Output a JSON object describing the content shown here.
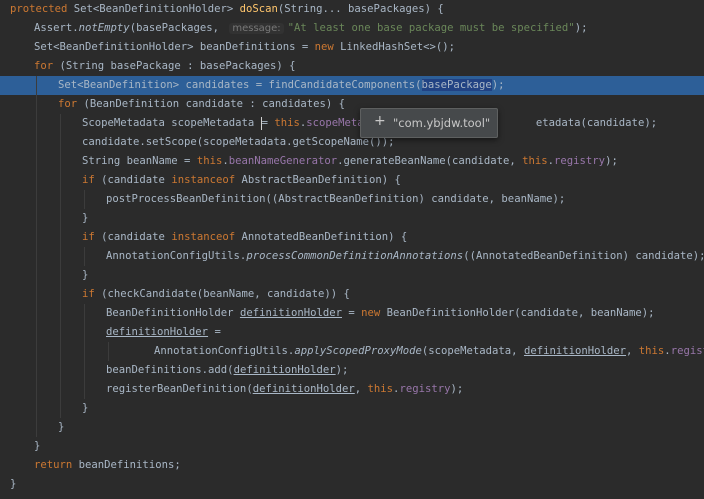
{
  "editor": {
    "lines": [
      {
        "tokens": [
          {
            "t": "protected ",
            "c": "kw"
          },
          {
            "t": "Set<BeanDefinitionHolder> "
          },
          {
            "t": "doScan",
            "c": "fn"
          },
          {
            "t": "(String... basePackages) {"
          }
        ]
      },
      {
        "tokens": [
          {
            "t": "Assert."
          },
          {
            "t": "notEmpty",
            "c": "it"
          },
          {
            "t": "(basePackages, "
          },
          {
            "t": "message:",
            "c": "hint"
          },
          {
            "t": "\"At least one base package must be specified\"",
            "c": "str"
          },
          {
            "t": ");"
          }
        ]
      },
      {
        "tokens": [
          {
            "t": "Set<BeanDefinitionHolder> beanDefinitions = "
          },
          {
            "t": "new ",
            "c": "kw"
          },
          {
            "t": "LinkedHashSet<>();"
          }
        ]
      },
      {
        "tokens": [
          {
            "t": "for ",
            "c": "kw"
          },
          {
            "t": "(String basePackage : basePackages) {"
          }
        ]
      },
      {
        "highlight": true,
        "tokens": [
          {
            "t": "Set<BeanDefinition> candidates = findCandidateComponents("
          },
          {
            "t": "basePackage",
            "c": "sel"
          },
          {
            "t": ");"
          }
        ]
      },
      {
        "tokens": [
          {
            "t": "for ",
            "c": "kw"
          },
          {
            "t": "(BeanDefinition candidate : candidates) {"
          }
        ]
      },
      {
        "tokens": [
          {
            "t": "ScopeMetadata scopeMetadata "
          },
          {
            "t": "",
            "c": "caret"
          },
          {
            "t": "= "
          },
          {
            "t": "this",
            "c": "kw"
          },
          {
            "t": "."
          },
          {
            "t": "scopeMetada",
            "c": "fld"
          },
          {
            "t": "                         "
          },
          {
            "t": "etadata(candidate);"
          }
        ]
      },
      {
        "tokens": [
          {
            "t": "candidate.setScope(scopeMetadata.getScopeName());"
          }
        ]
      },
      {
        "tokens": [
          {
            "t": "String beanName = "
          },
          {
            "t": "this",
            "c": "kw"
          },
          {
            "t": "."
          },
          {
            "t": "beanNameGenerator",
            "c": "fld"
          },
          {
            "t": ".generateBeanName(candidate, "
          },
          {
            "t": "this",
            "c": "kw"
          },
          {
            "t": "."
          },
          {
            "t": "registry",
            "c": "fld"
          },
          {
            "t": ");"
          }
        ]
      },
      {
        "tokens": [
          {
            "t": "if ",
            "c": "kw"
          },
          {
            "t": "(candidate "
          },
          {
            "t": "instanceof ",
            "c": "kw"
          },
          {
            "t": "AbstractBeanDefinition) {"
          }
        ]
      },
      {
        "tokens": [
          {
            "t": "postProcessBeanDefinition((AbstractBeanDefinition) candidate, beanName);"
          }
        ]
      },
      {
        "tokens": [
          {
            "t": "}"
          }
        ]
      },
      {
        "tokens": [
          {
            "t": "if ",
            "c": "kw"
          },
          {
            "t": "(candidate "
          },
          {
            "t": "instanceof ",
            "c": "kw"
          },
          {
            "t": "AnnotatedBeanDefinition) {"
          }
        ]
      },
      {
        "tokens": [
          {
            "t": "AnnotationConfigUtils."
          },
          {
            "t": "processCommonDefinitionAnnotations",
            "c": "it"
          },
          {
            "t": "((AnnotatedBeanDefinition) candidate);"
          }
        ]
      },
      {
        "tokens": [
          {
            "t": "}"
          }
        ]
      },
      {
        "tokens": [
          {
            "t": "if ",
            "c": "kw"
          },
          {
            "t": "(checkCandidate(beanName, candidate)) {"
          }
        ]
      },
      {
        "tokens": [
          {
            "t": "BeanDefinitionHolder "
          },
          {
            "t": "definitionHolder",
            "c": "ul"
          },
          {
            "t": " = "
          },
          {
            "t": "new ",
            "c": "kw"
          },
          {
            "t": "BeanDefinitionHolder(candidate, beanName);"
          }
        ]
      },
      {
        "tokens": [
          {
            "t": "definitionHolder",
            "c": "ul"
          },
          {
            "t": " ="
          }
        ]
      },
      {
        "tokens": [
          {
            "t": "AnnotationConfigUtils."
          },
          {
            "t": "applyScopedProxyMode",
            "c": "it"
          },
          {
            "t": "(scopeMetadata, "
          },
          {
            "t": "definitionHolder",
            "c": "ul"
          },
          {
            "t": ", "
          },
          {
            "t": "this",
            "c": "kw"
          },
          {
            "t": "."
          },
          {
            "t": "registry",
            "c": "fld"
          },
          {
            "t": ");"
          }
        ]
      },
      {
        "tokens": [
          {
            "t": "beanDefinitions.add("
          },
          {
            "t": "definitionHolder",
            "c": "ul"
          },
          {
            "t": ");"
          }
        ]
      },
      {
        "tokens": [
          {
            "t": "registerBeanDefinition("
          },
          {
            "t": "definitionHolder",
            "c": "ul"
          },
          {
            "t": ", "
          },
          {
            "t": "this",
            "c": "kw"
          },
          {
            "t": "."
          },
          {
            "t": "registry",
            "c": "fld"
          },
          {
            "t": ");"
          }
        ]
      },
      {
        "tokens": [
          {
            "t": "}"
          }
        ]
      },
      {
        "tokens": [
          {
            "t": "}"
          }
        ]
      },
      {
        "tokens": [
          {
            "t": "}"
          }
        ]
      },
      {
        "tokens": [
          {
            "t": "return ",
            "c": "kw"
          },
          {
            "t": "beanDefinitions;"
          }
        ]
      },
      {
        "tokens": [
          {
            "t": "}"
          }
        ]
      }
    ]
  },
  "debug_tooltip": {
    "expand_icon": "plus-icon",
    "value": "\"com.ybjdw.tool\""
  },
  "colors": {
    "background": "#2b2b2b",
    "text": "#a9b7c6",
    "keyword": "#cc7832",
    "method_declaration": "#ffc66d",
    "string": "#6a8759",
    "field": "#9876aa",
    "execution_line": "#2d5f98"
  }
}
